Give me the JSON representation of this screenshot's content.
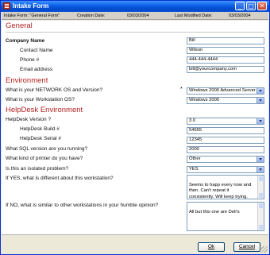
{
  "window": {
    "title": "Intake Form",
    "controls": {
      "minimize": "_",
      "maximize": "□",
      "close": "✕"
    }
  },
  "infobar": {
    "form_label": "Intake Form: \"General Form\"",
    "creation_label": "Creation Date:",
    "creation_date": "03/03/2004",
    "modified_label": "Last Modified Date:",
    "modified_date": "03/03/2004"
  },
  "general": {
    "title": "General",
    "company_label": "Company Name",
    "company_value": "Bill",
    "contact_label": "Contact Name",
    "contact_value": "Wilson",
    "phone_label": "Phone #",
    "phone_value": "444-444-4444",
    "email_label": "Email address",
    "email_value": "bill@yourcompany.com"
  },
  "environment": {
    "title": "Environment",
    "network_os_label": "What is your NETWORK OS and Version?",
    "required_marker": "*",
    "network_os_value": "Windows 2000 Advanced Server",
    "workstation_os_label": "What is your Workstation OS?",
    "workstation_os_value": "Windows 2000"
  },
  "helpdesk": {
    "title": "HelpDesk Environment",
    "version_label": "HelpDesk Version ?",
    "version_value": "3.0",
    "build_label": "HelpDesk Build #",
    "build_value": "54555",
    "serial_label": "HelpDesk Serial #",
    "serial_value": "12345",
    "sql_label": "What SQL version are you running?",
    "sql_value": "2000",
    "printer_label": "What kind of printer do you have?",
    "printer_value": "Other",
    "isolated_label": "Is this an isolated problem?",
    "isolated_value": "YES",
    "diff_label": "If YES, what is different about this workstation?",
    "diff_value": "Seems to happ every now and\nthen.  Can't repeat it\nconsistently.  Will keep trying.",
    "similar_label": "If NO, what is similar to other workstations in your humble opinion?",
    "similar_value": "All but this one are Dell's"
  },
  "buttons": {
    "ok": "Ok",
    "cancel": "Cancel"
  }
}
